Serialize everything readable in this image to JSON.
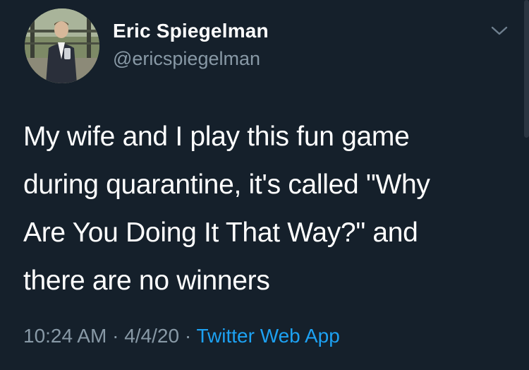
{
  "tweet": {
    "display_name": "Eric Spiegelman",
    "handle": "@ericspiegelman",
    "text": "My wife and I play this fun game\nduring quarantine, it's called \"Why\nAre You Doing It That Way?\" and\nthere are no winners",
    "time": "10:24 AM",
    "separator_1": " · ",
    "date": "4/4/20",
    "separator_2": " · ",
    "source": "Twitter Web App"
  },
  "icons": {
    "menu": "chevron-down-icon",
    "avatar": "profile-photo"
  },
  "colors": {
    "background": "#15202b",
    "primary_text": "#ffffff",
    "secondary_text": "#8899a6",
    "link": "#1da1f2"
  }
}
